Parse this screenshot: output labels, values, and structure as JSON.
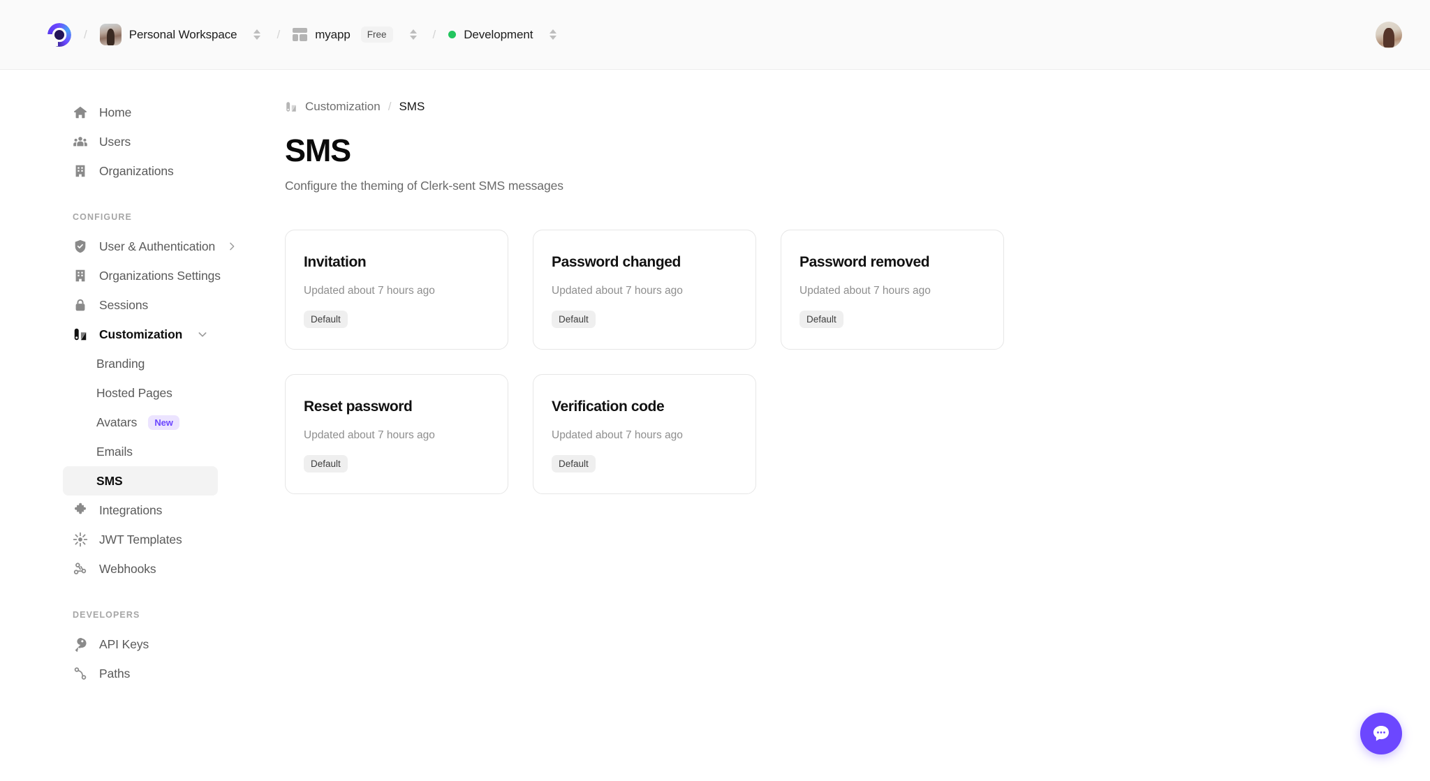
{
  "topbar": {
    "logo_icon": "clerk-logo-icon",
    "workspace": {
      "name": "Personal Workspace",
      "avatar_icon": "workspace-avatar",
      "switcher_icon": "chevron-updown-icon"
    },
    "application": {
      "name": "myapp",
      "plan": "Free",
      "app_icon": "app-grid-icon",
      "switcher_icon": "chevron-updown-icon"
    },
    "environment": {
      "name": "Development",
      "status_color": "#22c55e",
      "switcher_icon": "chevron-updown-icon"
    },
    "separator": "/",
    "user_avatar_icon": "user-avatar"
  },
  "sidebar": {
    "primary": [
      {
        "label": "Home",
        "icon": "home-icon"
      },
      {
        "label": "Users",
        "icon": "users-icon"
      },
      {
        "label": "Organizations",
        "icon": "building-icon"
      }
    ],
    "configure_label": "CONFIGURE",
    "configure": [
      {
        "label": "User & Authentication",
        "icon": "shield-check-icon",
        "chevron": "chevron-right-icon"
      },
      {
        "label": "Organizations Settings",
        "icon": "building-icon"
      },
      {
        "label": "Sessions",
        "icon": "lock-icon"
      },
      {
        "label": "Customization",
        "icon": "customization-icon",
        "chevron": "chevron-down-icon",
        "expanded": true
      }
    ],
    "customization_children": [
      {
        "label": "Branding"
      },
      {
        "label": "Hosted Pages"
      },
      {
        "label": "Avatars",
        "badge": "New"
      },
      {
        "label": "Emails"
      },
      {
        "label": "SMS",
        "active": true
      }
    ],
    "configure_tail": [
      {
        "label": "Integrations",
        "icon": "puzzle-icon"
      },
      {
        "label": "JWT Templates",
        "icon": "burst-icon"
      },
      {
        "label": "Webhooks",
        "icon": "webhook-icon"
      }
    ],
    "developers_label": "DEVELOPERS",
    "developers": [
      {
        "label": "API Keys",
        "icon": "key-icon"
      },
      {
        "label": "Paths",
        "icon": "paths-icon"
      }
    ]
  },
  "breadcrumb": {
    "icon": "customization-icon",
    "parent": "Customization",
    "separator": "/",
    "current": "SMS"
  },
  "page": {
    "title": "SMS",
    "subtitle": "Configure the theming of Clerk-sent SMS messages"
  },
  "templates": [
    {
      "title": "Invitation",
      "updated": "Updated about 7 hours ago",
      "badge": "Default"
    },
    {
      "title": "Password changed",
      "updated": "Updated about 7 hours ago",
      "badge": "Default"
    },
    {
      "title": "Password removed",
      "updated": "Updated about 7 hours ago",
      "badge": "Default"
    },
    {
      "title": "Reset password",
      "updated": "Updated about 7 hours ago",
      "badge": "Default"
    },
    {
      "title": "Verification code",
      "updated": "Updated about 7 hours ago",
      "badge": "Default"
    }
  ],
  "chat_widget": {
    "icon": "chat-bubble-icon",
    "accent_color": "#6c47ff"
  }
}
